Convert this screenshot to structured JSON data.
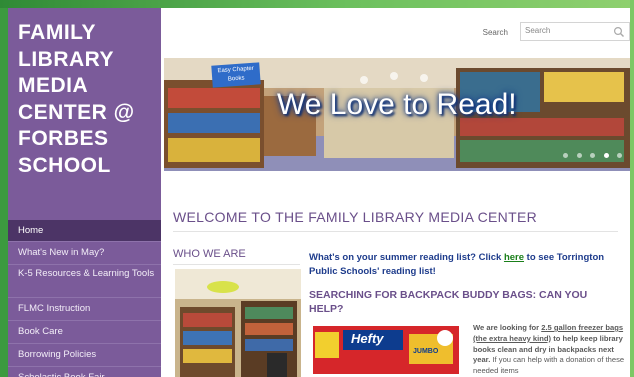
{
  "site": {
    "title_lines": [
      "FAMILY",
      "LIBRARY",
      "MEDIA",
      "CENTER @",
      "FORBES",
      "SCHOOL"
    ]
  },
  "nav": {
    "items": [
      {
        "label": "Home"
      },
      {
        "label": "What's New in May?"
      },
      {
        "label": "K-5 Resources & Learning Tools"
      },
      {
        "label": "FLMC Instruction"
      },
      {
        "label": "Book Care"
      },
      {
        "label": "Borrowing Policies"
      },
      {
        "label": "Scholastic Book Fair"
      }
    ],
    "active_index": 0
  },
  "search": {
    "label": "Search",
    "placeholder": "Search",
    "icon": "search-icon"
  },
  "banner": {
    "sign_text": "Easy Chapter Books",
    "headline": "We Love to Read!",
    "slide_count": 5,
    "active_slide": 3
  },
  "main": {
    "welcome_heading": "WELCOME TO THE FAMILY LIBRARY MEDIA CENTER",
    "who_heading": "WHO WE ARE",
    "summer_before": "What's on your summer reading list? Click ",
    "summer_link": "here",
    "summer_after": " to see Torrington Public Schools' reading list!",
    "backpack_heading": "SEARCHING FOR BACKPACK BUDDY BAGS: CAN YOU HELP?",
    "backpack_p1": "We are looking for ",
    "backpack_link": "2.5 gallon freezer bags (the extra heavy kind)",
    "backpack_p2": " to help keep library books clean and dry in backpacks next year.",
    "backpack_p3": " If you can help with a donation of these needed items",
    "hefty_brand": "Hefty",
    "hefty_tag": "JUMBO"
  },
  "colors": {
    "sidebar": "#7b5b9a",
    "nav_active": "#4c3466",
    "heading_purple": "#6a4f8a",
    "link_blue": "#1e3c8c",
    "link_green": "#1a7f1a",
    "frame_green": "#3c9a3f"
  }
}
